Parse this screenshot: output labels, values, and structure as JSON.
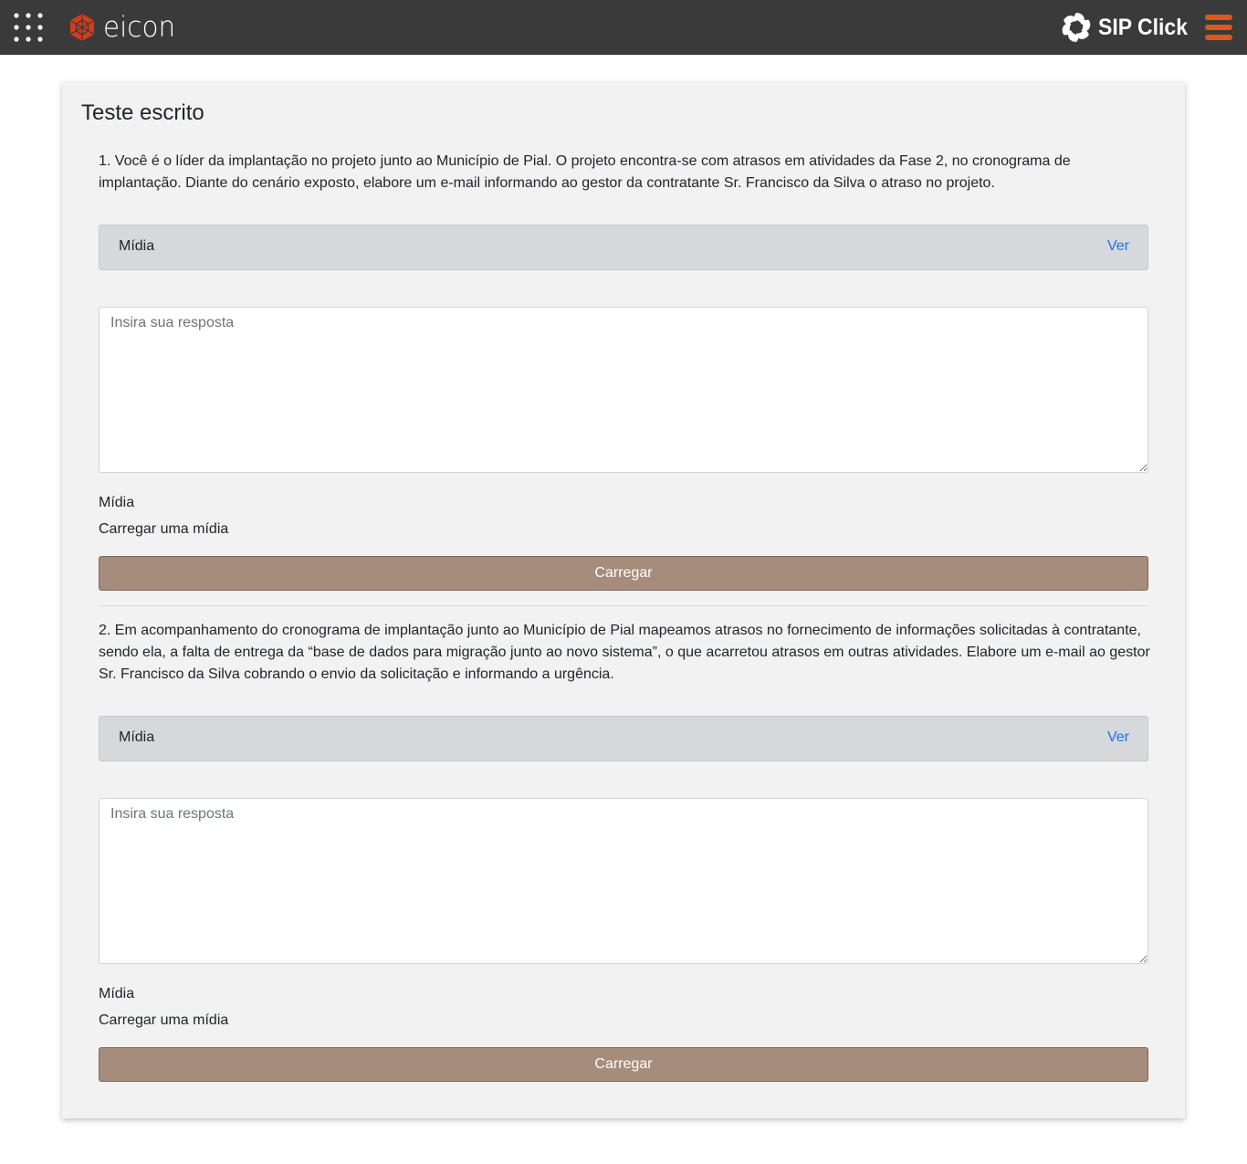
{
  "header": {
    "brand_name": "eicon",
    "product_name": "SIP Click",
    "accent_color": "#e0561e",
    "bar_color": "#3a3a3a",
    "apps_icon": "grid-dots-icon",
    "menu_icon": "hamburger-icon"
  },
  "card": {
    "title": "Teste escrito"
  },
  "questions": [
    {
      "text": "1. Você é o líder da implantação no projeto junto ao Município de Pial. O  projeto encontra-se com atrasos em atividades da Fase 2, no cronograma de implantação. Diante do cenário exposto, elabore um e-mail informando ao gestor da contratante Sr. Francisco da Silva o atraso no projeto.",
      "media_bar_label": "Mídia",
      "media_bar_link": "Ver",
      "answer_placeholder": "Insira sua resposta",
      "media_label": "Mídia",
      "upload_label": "Carregar uma mídia",
      "upload_button": "Carregar"
    },
    {
      "text": "2. Em acompanhamento do cronograma de implantação junto ao Município de Pial mapeamos atrasos no fornecimento de informações solicitadas à contratante, sendo ela, a falta de entrega da “base de dados para migração junto ao novo sistema”, o que acarretou atrasos em outras atividades. Elabore um e-mail ao gestor Sr. Francisco da Silva cobrando o envio da solicitação e informando a urgência.",
      "media_bar_label": "Mídia",
      "media_bar_link": "Ver",
      "answer_placeholder": "Insira sua resposta",
      "media_label": "Mídia",
      "upload_label": "Carregar uma mídia",
      "upload_button": "Carregar"
    }
  ]
}
